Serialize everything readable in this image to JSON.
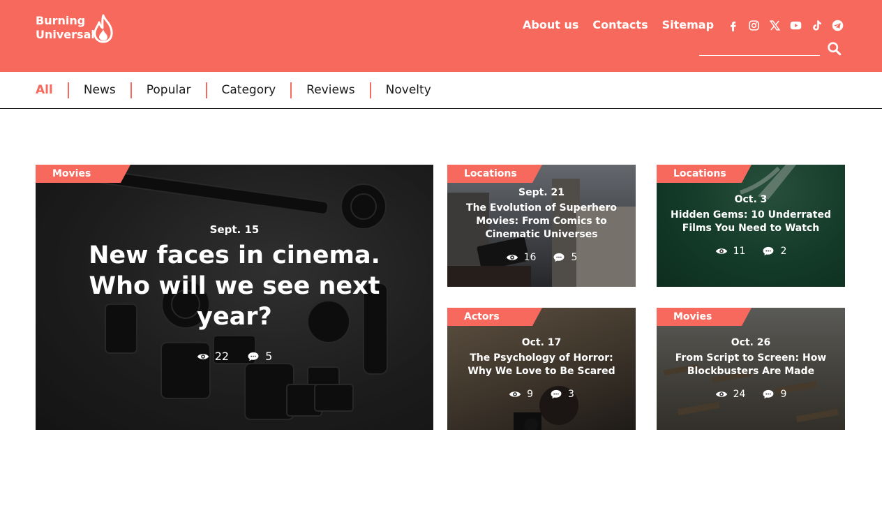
{
  "brand": {
    "line1": "Burning",
    "line2": "Universal"
  },
  "top_nav": [
    "About us",
    "Contacts",
    "Sitemap"
  ],
  "socials": [
    "facebook-icon",
    "instagram-icon",
    "x-icon",
    "youtube-icon",
    "tiktok-icon",
    "telegram-icon"
  ],
  "search": {
    "placeholder": ""
  },
  "categories": [
    "All",
    "News",
    "Popular",
    "Category",
    "Reviews",
    "Novelty"
  ],
  "active_category": "All",
  "colors": {
    "accent": "#f8695d",
    "text": "#1a1a1a"
  },
  "cards": [
    {
      "tag": "Movies",
      "date": "Sept. 15",
      "title": "New faces in cinema. Who will we see next year?",
      "views": "22",
      "comments": "5"
    },
    {
      "tag": "Locations",
      "date": "Sept. 21",
      "title": "The Evolution of Superhero Movies: From Comics to Cinematic Universes",
      "views": "16",
      "comments": "5"
    },
    {
      "tag": "Locations",
      "date": "Oct. 3",
      "title": "Hidden Gems: 10 Underrated Films You Need to Watch",
      "views": "11",
      "comments": "2"
    },
    {
      "tag": "Actors",
      "date": "Oct. 17",
      "title": "The Psychology of Horror: Why We Love to Be Scared",
      "views": "9",
      "comments": "3"
    },
    {
      "tag": "Movies",
      "date": "Oct. 26",
      "title": "From Script to Screen: How Blockbusters Are Made",
      "views": "24",
      "comments": "9"
    }
  ]
}
